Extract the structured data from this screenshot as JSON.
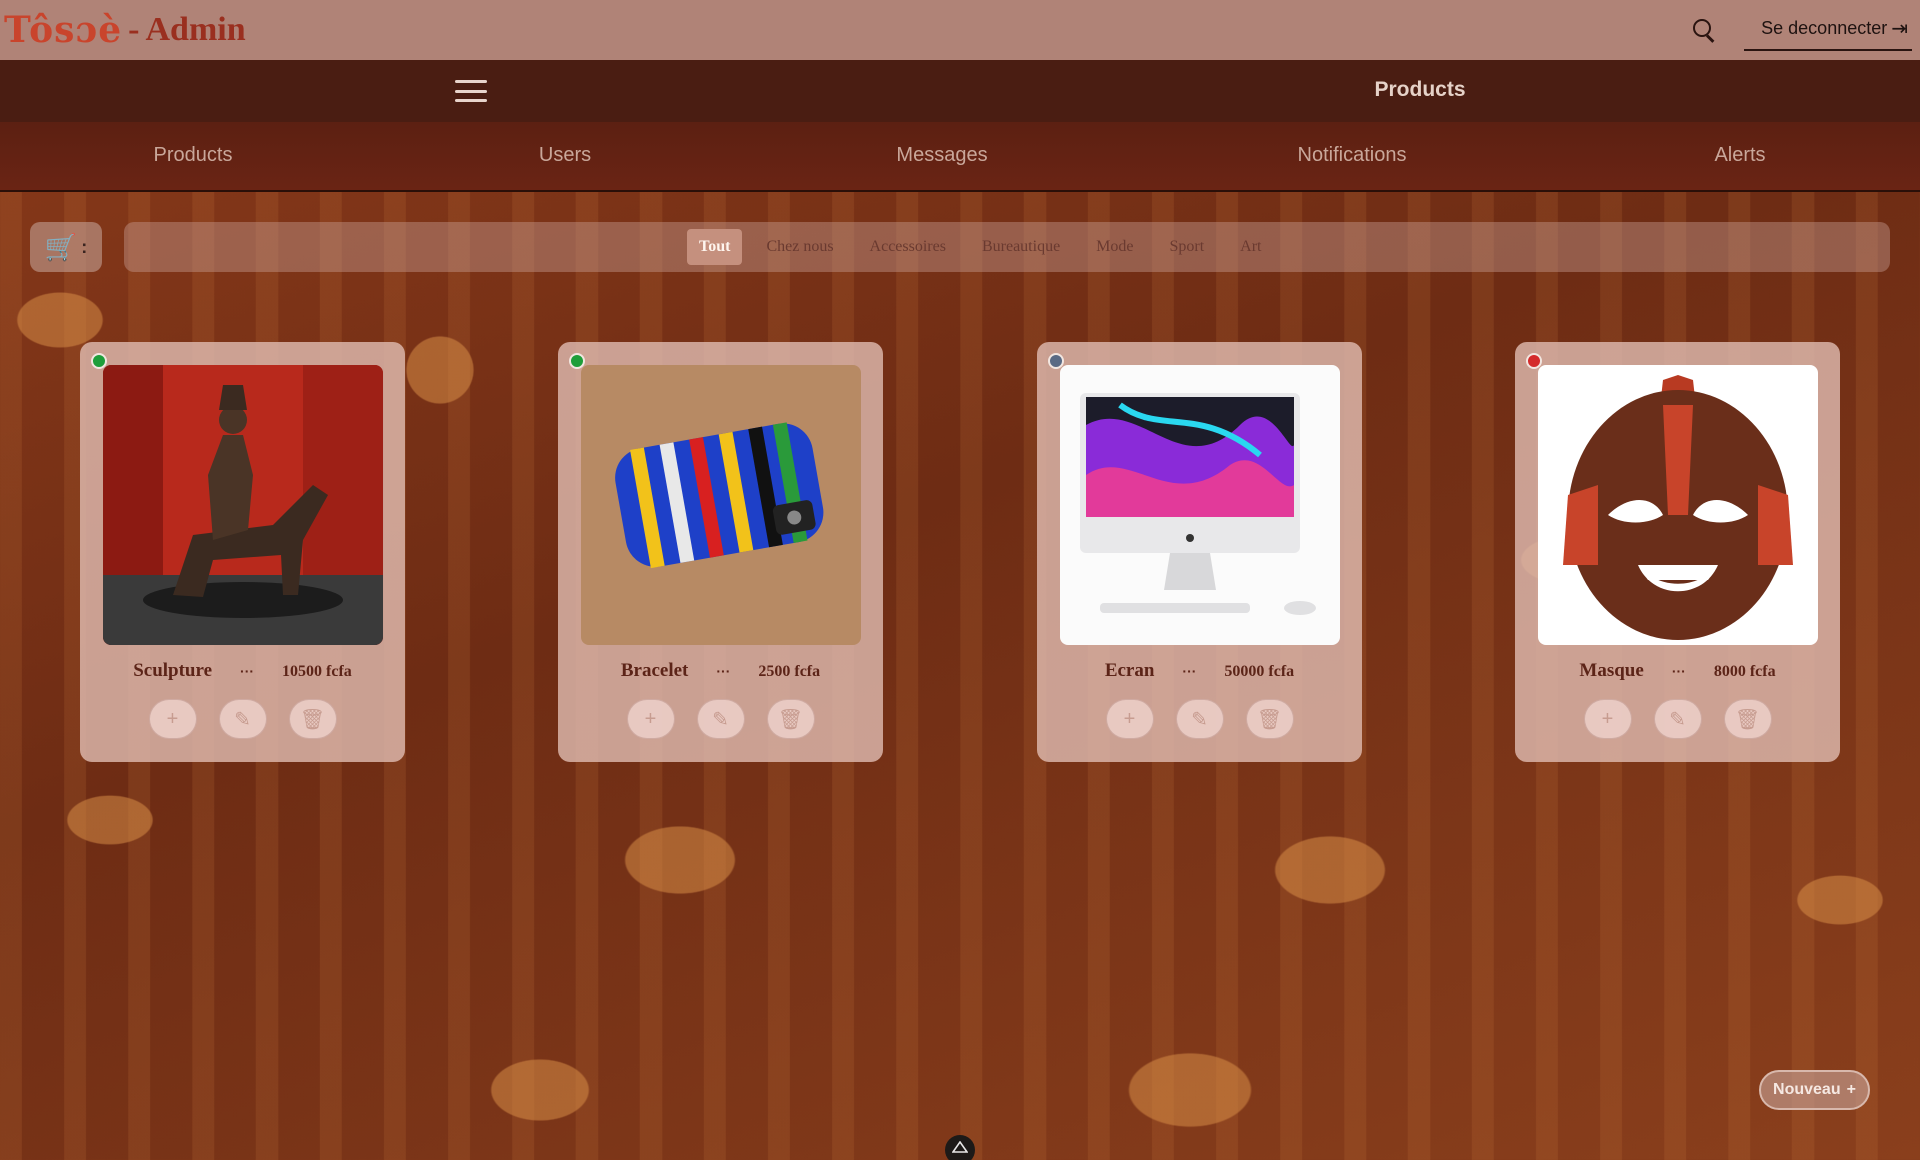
{
  "header": {
    "brand_logo": "Tôsɔè",
    "brand_separator": "-",
    "brand_suffix": "Admin",
    "logout_label": "Se deconnecter"
  },
  "subbar": {
    "title": "Products"
  },
  "nav": {
    "items": [
      {
        "label": "Products"
      },
      {
        "label": "Users"
      },
      {
        "label": "Messages"
      },
      {
        "label": "Notifications"
      },
      {
        "label": "Alerts"
      }
    ]
  },
  "filters": {
    "cart_separator": ":",
    "categories": [
      "Tout",
      "Chez nous",
      "Accessoires",
      "Bureautique",
      "Mode",
      "Sport",
      "Art"
    ],
    "active": "Tout"
  },
  "products": [
    {
      "name": "Sculpture",
      "menu": "···",
      "price": "10500 fcfa",
      "status_color": "#1e9e3a"
    },
    {
      "name": "Bracelet",
      "menu": "···",
      "price": "2500 fcfa",
      "status_color": "#1e9e3a"
    },
    {
      "name": "Ecran",
      "menu": "···",
      "price": "50000 fcfa",
      "status_color": "#5a6a84"
    },
    {
      "name": "Masque",
      "menu": "···",
      "price": "8000 fcfa",
      "status_color": "#d42b2b"
    }
  ],
  "actions": {
    "add": "+",
    "edit": "✎",
    "delete": "🗑"
  },
  "nouveau": {
    "label": "Nouveau",
    "icon": "+"
  },
  "icons": {
    "search": "search-icon",
    "logout": "logout-icon",
    "menu": "hamburger-menu-icon",
    "cart": "cart-icon"
  },
  "colors": {
    "header_bg": "#b08377",
    "subbar_bg": "#4a1d12",
    "accent": "#9a2f1f",
    "chip_active": "#c5907e"
  }
}
